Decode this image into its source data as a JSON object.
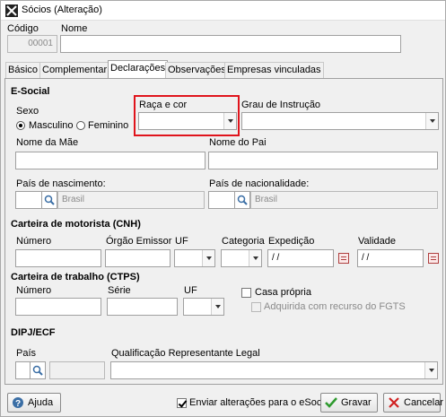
{
  "window": {
    "title": "Sócios (Alteração)"
  },
  "header": {
    "codigo_label": "Código",
    "codigo_value": "00001",
    "nome_label": "Nome",
    "nome_value": ""
  },
  "tabs": [
    {
      "label": "Básico",
      "active": false
    },
    {
      "label": "Complementar",
      "active": false
    },
    {
      "label": "Declarações",
      "active": true
    },
    {
      "label": "Observações",
      "active": false
    },
    {
      "label": "Empresas vinculadas",
      "active": false
    }
  ],
  "esocial": {
    "section_title": "E-Social",
    "sexo_label": "Sexo",
    "sexo_options": [
      "Masculino",
      "Feminino"
    ],
    "sexo_selected": "Masculino",
    "raca_label": "Raça e cor",
    "raca_value": "",
    "grau_label": "Grau de Instrução",
    "grau_value": "",
    "mae_label": "Nome da Mãe",
    "pai_label": "Nome do Pai",
    "pais_nasc_label": "País de nascimento:",
    "pais_nasc_value": "Brasil",
    "pais_nac_label": "País de nacionalidade:",
    "pais_nac_value": "Brasil"
  },
  "cnh": {
    "section_title": "Carteira de motorista (CNH)",
    "numero_label": "Número",
    "orgao_label": "Órgão Emissor",
    "uf_label": "UF",
    "categoria_label": "Categoria",
    "expedicao_label": "Expedição",
    "expedicao_value": " /  /",
    "validade_label": "Validade",
    "validade_value": " /  /"
  },
  "ctps": {
    "section_title": "Carteira de trabalho (CTPS)",
    "numero_label": "Número",
    "serie_label": "Série",
    "uf_label": "UF",
    "casa_propria_label": "Casa própria",
    "casa_propria_checked": false,
    "fgts_label": "Adquirida com recurso do FGTS",
    "fgts_checked": false
  },
  "dipj": {
    "section_title": "DIPJ/ECF",
    "pais_label": "País",
    "qualificacao_label": "Qualificação Representante Legal"
  },
  "footer": {
    "ajuda_label": "Ajuda",
    "enviar_label": "Enviar alterações para o eSocial",
    "enviar_checked": true,
    "gravar_label": "Gravar",
    "cancelar_label": "Cancelar"
  },
  "colors": {
    "highlight": "#e0141c",
    "ok_green": "#2e9a2e",
    "cancel_red": "#d02020"
  }
}
